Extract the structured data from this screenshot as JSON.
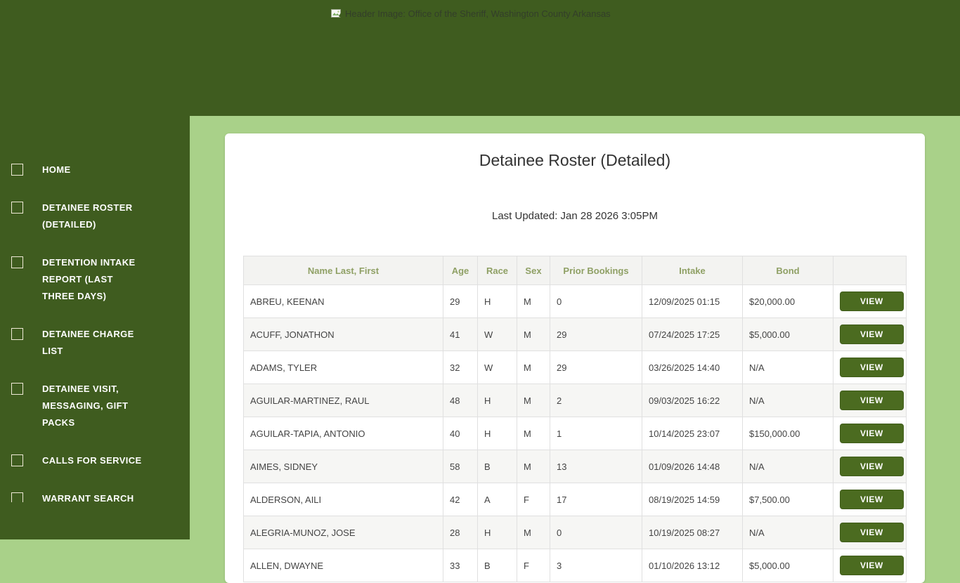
{
  "header": {
    "alt_text": "Header Image: Office of the Sheriff, Washington County Arkansas"
  },
  "sidebar": {
    "items": [
      {
        "label": "HOME"
      },
      {
        "label": "DETAINEE ROSTER (DETAILED)"
      },
      {
        "label": "DETENTION INTAKE REPORT (LAST THREE DAYS)"
      },
      {
        "label": "DETAINEE CHARGE LIST"
      },
      {
        "label": "DETAINEE VISIT, MESSAGING, GIFT PACKS"
      },
      {
        "label": "CALLS FOR SERVICE"
      },
      {
        "label": "WARRANT SEARCH"
      }
    ]
  },
  "main": {
    "title": "Detainee Roster (Detailed)",
    "last_updated": "Last Updated: Jan 28 2026 3:05PM",
    "table": {
      "columns": [
        "Name Last, First",
        "Age",
        "Race",
        "Sex",
        "Prior Bookings",
        "Intake",
        "Bond",
        ""
      ],
      "view_label": "VIEW",
      "rows": [
        {
          "name": "ABREU, KEENAN",
          "age": "29",
          "race": "H",
          "sex": "M",
          "prior_bookings": "0",
          "intake": "12/09/2025 01:15",
          "bond": "$20,000.00"
        },
        {
          "name": "ACUFF, JONATHON",
          "age": "41",
          "race": "W",
          "sex": "M",
          "prior_bookings": "29",
          "intake": "07/24/2025 17:25",
          "bond": "$5,000.00"
        },
        {
          "name": "ADAMS, TYLER",
          "age": "32",
          "race": "W",
          "sex": "M",
          "prior_bookings": "29",
          "intake": "03/26/2025 14:40",
          "bond": "N/A"
        },
        {
          "name": "AGUILAR-MARTINEZ, RAUL",
          "age": "48",
          "race": "H",
          "sex": "M",
          "prior_bookings": "2",
          "intake": "09/03/2025 16:22",
          "bond": "N/A"
        },
        {
          "name": "AGUILAR-TAPIA, ANTONIO",
          "age": "40",
          "race": "H",
          "sex": "M",
          "prior_bookings": "1",
          "intake": "10/14/2025 23:07",
          "bond": "$150,000.00"
        },
        {
          "name": "AIMES, SIDNEY",
          "age": "58",
          "race": "B",
          "sex": "M",
          "prior_bookings": "13",
          "intake": "01/09/2026 14:48",
          "bond": "N/A"
        },
        {
          "name": "ALDERSON, AILI",
          "age": "42",
          "race": "A",
          "sex": "F",
          "prior_bookings": "17",
          "intake": "08/19/2025 14:59",
          "bond": "$7,500.00"
        },
        {
          "name": "ALEGRIA-MUNOZ, JOSE",
          "age": "28",
          "race": "H",
          "sex": "M",
          "prior_bookings": "0",
          "intake": "10/19/2025 08:27",
          "bond": "N/A"
        },
        {
          "name": "ALLEN, DWAYNE",
          "age": "33",
          "race": "B",
          "sex": "F",
          "prior_bookings": "3",
          "intake": "01/10/2026 13:12",
          "bond": "$5,000.00"
        }
      ]
    }
  },
  "colors": {
    "dark_green": "#3f5c1f",
    "light_green": "#a9d189",
    "button_green": "#4b6b20",
    "table_header_text": "#8fa065"
  }
}
